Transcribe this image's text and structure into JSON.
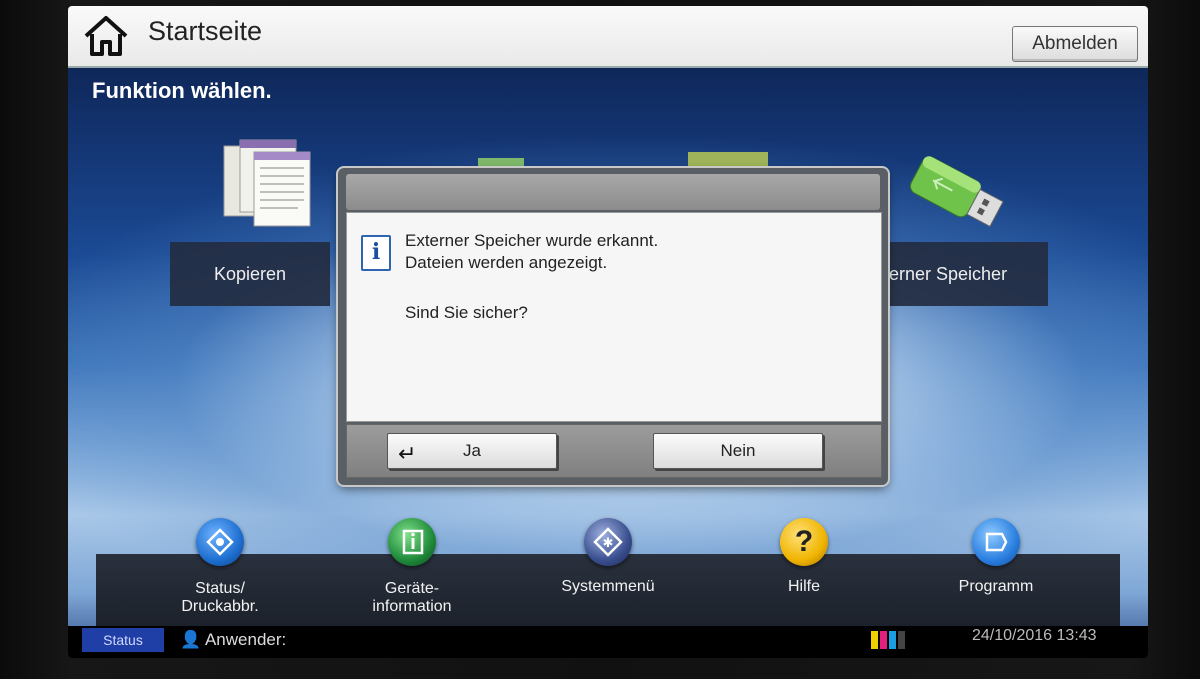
{
  "header": {
    "title": "Startseite",
    "logout_label": "Abmelden"
  },
  "main": {
    "instruction": "Funktion wählen.",
    "tiles": [
      {
        "label": "Kopieren"
      },
      {
        "label": "terner Speicher"
      }
    ]
  },
  "dialog": {
    "line1": "Externer Speicher wurde erkannt.",
    "line2": "Dateien werden angezeigt.",
    "question": "Sind Sie sicher?",
    "yes_label": "Ja",
    "no_label": "Nein"
  },
  "bottom_nav": [
    {
      "line1": "Status/",
      "line2": "Druckabbr."
    },
    {
      "line1": "Geräte-",
      "line2": "information"
    },
    {
      "line1": "Systemmenü",
      "line2": ""
    },
    {
      "line1": "Hilfe",
      "line2": ""
    },
    {
      "line1": "Programm",
      "line2": ""
    }
  ],
  "statusbar": {
    "status_tab": "Status",
    "user_label": "Anwender:",
    "datetime": "24/10/2016 13:43"
  },
  "colors": {
    "status_tab": "#1f3fa6",
    "nav_status": "#1e6fd0",
    "nav_device": "#1f8a3a",
    "nav_system": "#3a4f8f",
    "nav_help": "#f0b400",
    "nav_program": "#2a7fe0"
  },
  "icons": [
    "home-icon",
    "copy-icon",
    "usb-icon",
    "info-icon",
    "enter-icon",
    "eye-icon",
    "device-info-icon",
    "system-menu-icon",
    "help-icon",
    "program-icon",
    "user-icon",
    "toner-icon"
  ]
}
